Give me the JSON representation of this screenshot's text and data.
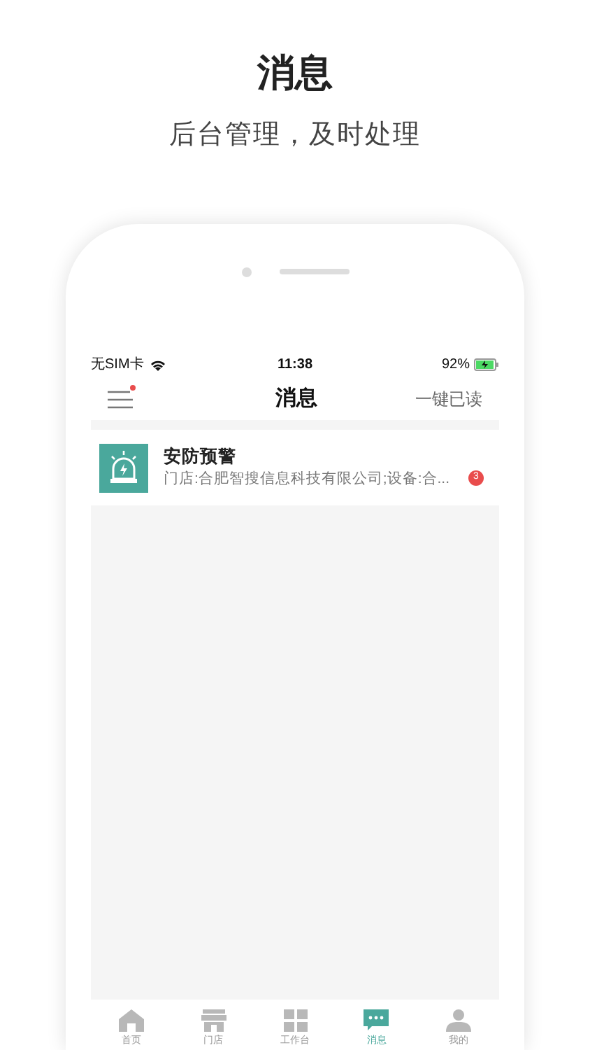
{
  "promo": {
    "title": "消息",
    "subtitle": "后台管理，及时处理"
  },
  "status_bar": {
    "carrier": "无SIM卡",
    "time": "11:38",
    "battery": "92%"
  },
  "nav": {
    "title": "消息",
    "action": "一键已读",
    "menu_dot": true
  },
  "messages": [
    {
      "title": "安防预警",
      "preview": "门店:合肥智搜信息科技有限公司;设备:合...",
      "count": "3"
    }
  ],
  "tabs": [
    {
      "label": "首页",
      "kind": "home",
      "selected": false
    },
    {
      "label": "门店",
      "kind": "store",
      "selected": false
    },
    {
      "label": "工作台",
      "kind": "grid",
      "selected": false
    },
    {
      "label": "消息",
      "kind": "chat",
      "selected": true
    },
    {
      "label": "我的",
      "kind": "person",
      "selected": false
    }
  ]
}
